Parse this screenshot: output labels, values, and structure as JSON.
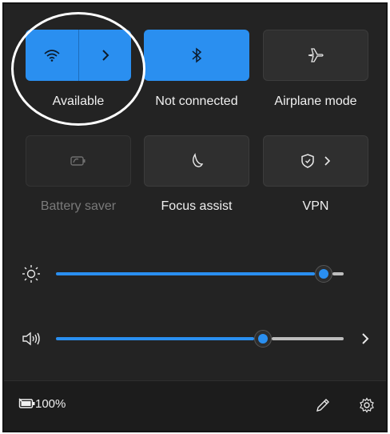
{
  "tiles": [
    {
      "label": "Available",
      "icon": "wifi-icon",
      "extra_icon": "chevron-right-icon",
      "state": "active"
    },
    {
      "label": "Not connected",
      "icon": "bluetooth-icon",
      "state": "active"
    },
    {
      "label": "Airplane mode",
      "icon": "airplane-icon",
      "state": "off"
    },
    {
      "label": "Battery saver",
      "icon": "battery-saver-icon",
      "state": "disabled"
    },
    {
      "label": "Focus assist",
      "icon": "moon-icon",
      "state": "off"
    },
    {
      "label": "VPN",
      "icon": "shield-icon",
      "extra_icon": "chevron-right-icon",
      "state": "off"
    }
  ],
  "brightness": {
    "icon": "sun-icon",
    "value_fraction": 0.93
  },
  "volume": {
    "icon": "speaker-icon",
    "value_fraction": 0.72,
    "extra_icon": "chevron-right-icon"
  },
  "footer": {
    "battery_icon": "battery-charging-icon",
    "battery_percent": "100%",
    "edit_icon": "pencil-icon",
    "settings_icon": "gear-icon"
  },
  "colors": {
    "accent": "#2a8ff0",
    "background": "#232323",
    "footer": "#1c1c1c"
  }
}
